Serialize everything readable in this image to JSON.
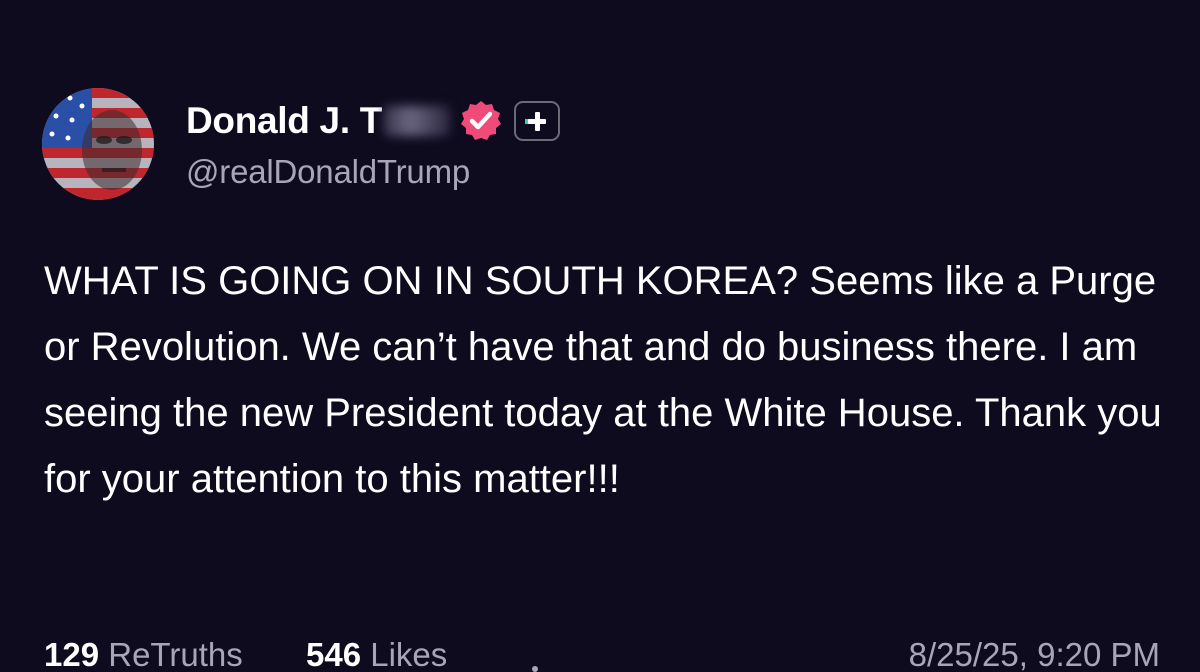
{
  "post": {
    "author": {
      "display_name": "Donald J. T",
      "handle": "@realDonaldTrump",
      "avatar_icon": "flag-portrait-avatar",
      "verified_icon": "verified-badge-icon",
      "verified_color": "#ef4a7a",
      "plus_icon": "plus-badge-icon"
    },
    "content": "WHAT IS GOING ON IN SOUTH KOREA? Seems like a Purge or Revolution. We can’t have that and do business there. I am seeing the new President today at the White House. Thank you for your attention to this matter!!!",
    "stats": {
      "retruths_count": "129",
      "retruths_label": "ReTruths",
      "likes_count": "546",
      "likes_label": "Likes"
    },
    "timestamp": "8/25/25, 9:20 PM"
  },
  "colors": {
    "background": "#0e0b1e",
    "text_primary": "#ffffff",
    "text_secondary": "#a7a5b6",
    "accent_teal": "#35d3b8"
  }
}
